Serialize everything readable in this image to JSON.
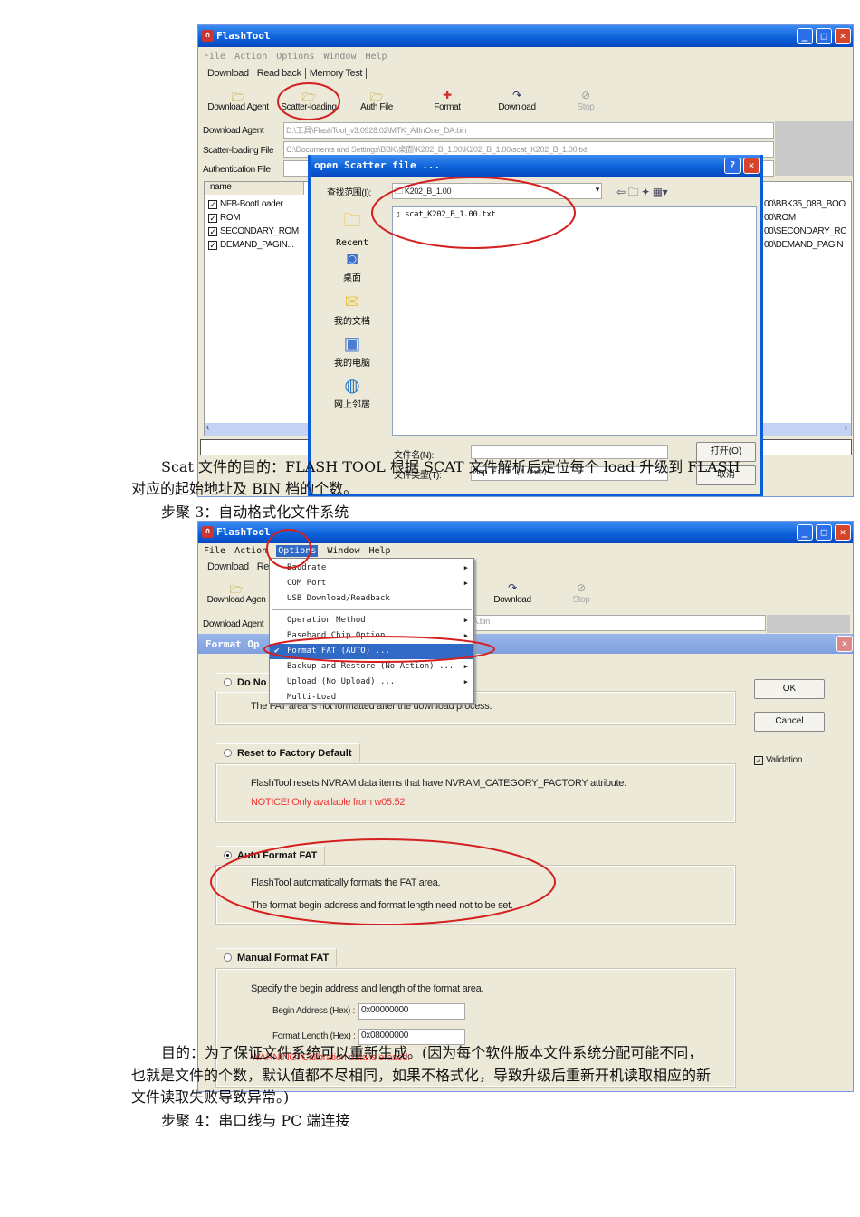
{
  "shot1": {
    "title": "FlashTool",
    "menu": [
      "File",
      "Action",
      "Options",
      "Window",
      "Help"
    ],
    "tabs": [
      "Download",
      "Read back",
      "Memory Test"
    ],
    "toolbar": [
      "Download Agent",
      "Scatter-loading",
      "Auth File",
      "Format",
      "Download",
      "Stop"
    ],
    "fields": [
      {
        "label": "Download Agent",
        "value": "D:\\工具\\FlashTool_v3.0928.02\\MTK_AllInOne_DA.bin"
      },
      {
        "label": "Scatter-loading File",
        "value": "C:\\Documents and Settings\\BBK\\桌面\\K202_B_1.00\\K202_B_1.00\\scat_K202_B_1.00.txt"
      },
      {
        "label": "Authentication File",
        "value": ""
      }
    ],
    "list_header": "name",
    "list": [
      {
        "name": "NFB-BootLoader",
        "path": "00\\BBK35_08B_BOO"
      },
      {
        "name": "ROM",
        "path": "00\\ROM"
      },
      {
        "name": "SECONDARY_ROM",
        "path": "00\\SECONDARY_RC"
      },
      {
        "name": "DEMAND_PAGIN...",
        "path": "00\\DEMAND_PAGIN"
      }
    ],
    "dialog": {
      "title": "open Scatter file ...",
      "look_in_label": "查找范围(I):",
      "look_in_value": "K202_B_1.00",
      "places": [
        "Recent",
        "桌面",
        "我的文档",
        "我的电脑",
        "网上邻居"
      ],
      "file": "scat_K202_B_1.00.txt",
      "filename_label": "文件名(N):",
      "filetype_label": "文件类型(T):",
      "filetype_value": "Map File (*.txt)",
      "open": "打开(O)",
      "cancel": "取消"
    }
  },
  "para1": [
    "Scat 文件的目的：FLASH  TOOL 根据 SCAT 文件解析后定位每个 load 升级到 FLASH",
    "对应的起始地址及 BIN 档的个数。"
  ],
  "step3": "步聚 3：自动格式化文件系统",
  "shot2": {
    "title": "FlashTool",
    "menu": [
      "File",
      "Action",
      "Options",
      "Window",
      "Help"
    ],
    "tabs": [
      "Download",
      "Re"
    ],
    "toolbar": [
      "Download Agen",
      "Download",
      "Stop"
    ],
    "field_label": "Download Agent",
    "field_value": "A.bin",
    "options_menu": [
      {
        "label": "Baudrate",
        "sub": true
      },
      {
        "label": "COM Port",
        "sub": true
      },
      {
        "label": "USB Download/Readback",
        "sub": false
      },
      {
        "label": "Operation Method",
        "sub": true
      },
      {
        "label": "Baseband Chip Option",
        "sub": true
      },
      {
        "label": "Format FAT (AUTO) ...",
        "sub": false,
        "checked": true
      },
      {
        "label": "Backup and Restore (No Action) ...",
        "sub": true
      },
      {
        "label": "Upload (No Upload) ...",
        "sub": true
      },
      {
        "label": "Multi-Load",
        "sub": false
      }
    ],
    "dialog_title": "Format Op",
    "groups": {
      "donot": {
        "title": "Do No",
        "text": "The FAT area is not formatted after the download process."
      },
      "reset": {
        "title": "Reset to Factory Default",
        "text": "FlashTool resets  NVRAM data items that have NVRAM_CATEGORY_FACTORY attribute.",
        "notice": "NOTICE! Only available from w05.52."
      },
      "auto": {
        "title": "Auto Format FAT",
        "text1": "FlashTool automatically formats the FAT area.",
        "text2": "The format begin address and  format length need not to be set."
      },
      "manual": {
        "title": "Manual Format FAT",
        "text": "Specify the begin address and length of the format area.",
        "begin_label": "Begin Address (Hex) :",
        "begin_value": "0x00000000",
        "length_label": "Format Length (Hex) :",
        "length_value": "0x08000000",
        "warning": "WARNING! Calibration data is erased."
      }
    },
    "ok": "OK",
    "cancel": "Cancel",
    "validation": "Validation"
  },
  "para2": [
    "目的：为了保证文件系统可以重新生成。(因为每个软件版本文件系统分配可能不同，",
    "也就是文件的个数，默认值都不尽相同，如果不格式化，导致升级后重新开机读取相应的新",
    "文件读取失败导致异常。)"
  ],
  "step4": "步聚 4：串口线与 PC 端连接",
  "colors": {
    "titlebar": "#0a5fd8",
    "window_bg": "#ece9d8",
    "annotation": "#d42020",
    "menu_highlight": "#316ac5"
  }
}
